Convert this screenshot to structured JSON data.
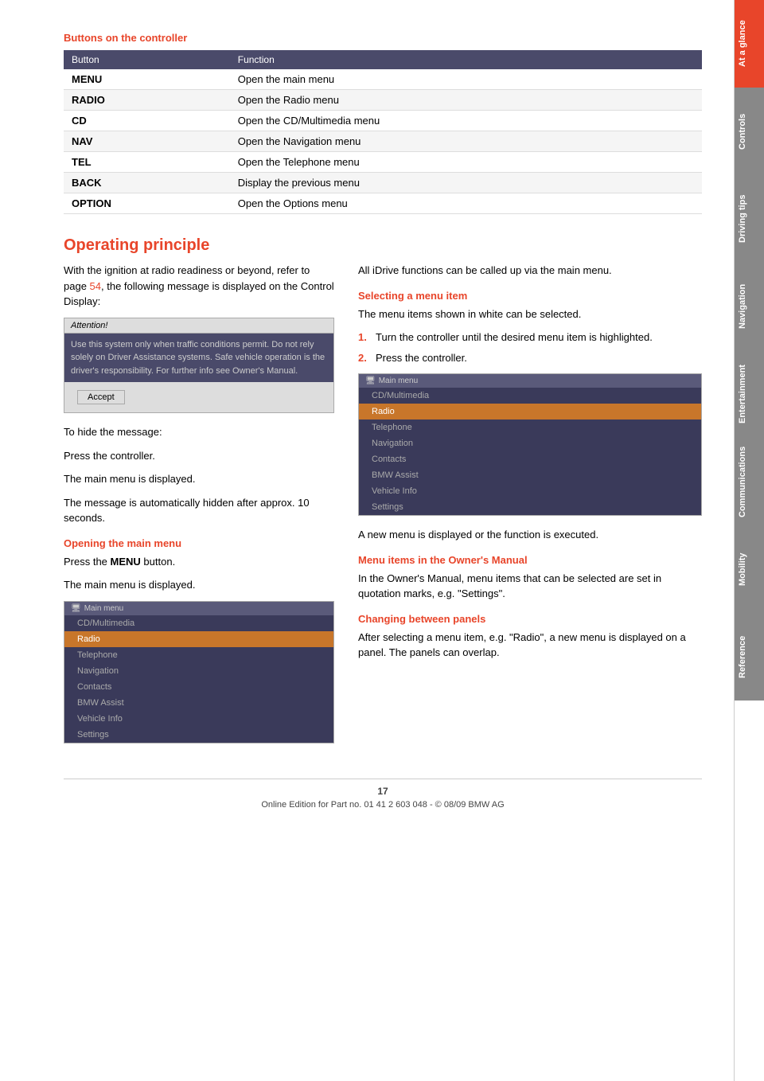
{
  "sidebar": {
    "sections": [
      {
        "label": "At a glance",
        "color": "#e8452a"
      },
      {
        "label": "Controls",
        "color": "#888"
      },
      {
        "label": "Driving tips",
        "color": "#888"
      },
      {
        "label": "Navigation",
        "color": "#888"
      },
      {
        "label": "Entertainment",
        "color": "#888"
      },
      {
        "label": "Communications",
        "color": "#888"
      },
      {
        "label": "Mobility",
        "color": "#888"
      },
      {
        "label": "Reference",
        "color": "#888"
      }
    ]
  },
  "buttons_section": {
    "title": "Buttons on the controller",
    "table": {
      "headers": [
        "Button",
        "Function"
      ],
      "rows": [
        [
          "MENU",
          "Open the main menu"
        ],
        [
          "RADIO",
          "Open the Radio menu"
        ],
        [
          "CD",
          "Open the CD/Multimedia menu"
        ],
        [
          "NAV",
          "Open the Navigation menu"
        ],
        [
          "TEL",
          "Open the Telephone menu"
        ],
        [
          "BACK",
          "Display the previous menu"
        ],
        [
          "OPTION",
          "Open the Options menu"
        ]
      ]
    }
  },
  "operating_principle": {
    "title": "Operating principle",
    "intro": "With the ignition at radio readiness or beyond, refer to page ",
    "page_ref": "54",
    "intro_cont": ", the following message is displayed on the Control Display:",
    "attention": {
      "header": "Attention!",
      "body": "Use this system only when traffic conditions permit. Do not rely solely on Driver Assistance systems. Safe vehicle operation is the driver's responsibility. For further info see Owner's Manual.",
      "accept_label": "Accept"
    },
    "to_hide": "To hide the message:",
    "press_controller": "Press the controller.",
    "main_menu_displayed": "The main menu is displayed.",
    "auto_hidden": "The message is automatically hidden after approx. 10 seconds.",
    "open_main_menu_heading": "Opening the main menu",
    "press_menu": "Press the ",
    "menu_bold": "MENU",
    "press_menu_cont": " button.",
    "main_menu_displayed2": "The main menu is displayed.",
    "screen_title": "Main menu",
    "screen_items": [
      {
        "label": "CD/Multimedia",
        "type": "normal"
      },
      {
        "label": "Radio",
        "type": "highlighted"
      },
      {
        "label": "Telephone",
        "type": "normal"
      },
      {
        "label": "Navigation",
        "type": "normal"
      },
      {
        "label": "Contacts",
        "type": "normal"
      },
      {
        "label": "BMW Assist",
        "type": "normal"
      },
      {
        "label": "Vehicle Info",
        "type": "normal"
      },
      {
        "label": "Settings",
        "type": "normal"
      }
    ]
  },
  "right_col": {
    "all_idrive": "All iDrive functions can be called up via the main menu.",
    "selecting_heading": "Selecting a menu item",
    "selecting_intro": "The menu items shown in white can be selected.",
    "numbered_steps": [
      "Turn the controller until the desired menu item is highlighted.",
      "Press the controller."
    ],
    "after_select": "A new menu is displayed or the function is executed.",
    "screen2_title": "Main menu",
    "screen2_items": [
      {
        "label": "CD/Multimedia",
        "type": "normal"
      },
      {
        "label": "Radio",
        "type": "highlighted"
      },
      {
        "label": "Telephone",
        "type": "normal"
      },
      {
        "label": "Navigation",
        "type": "normal"
      },
      {
        "label": "Contacts",
        "type": "normal"
      },
      {
        "label": "BMW Assist",
        "type": "normal"
      },
      {
        "label": "Vehicle Info",
        "type": "normal"
      },
      {
        "label": "Settings",
        "type": "normal"
      }
    ],
    "menu_items_manual_heading": "Menu items in the Owner's Manual",
    "menu_items_manual_text": "In the Owner's Manual, menu items that can be selected are set in quotation marks, e.g. \"Settings\".",
    "changing_panels_heading": "Changing between panels",
    "changing_panels_text": "After selecting a menu item, e.g. \"Radio\", a new menu is displayed on a panel. The panels can overlap."
  },
  "footer": {
    "page_number": "17",
    "copyright": "Online Edition for Part no. 01 41 2 603 048 - © 08/09 BMW AG"
  }
}
